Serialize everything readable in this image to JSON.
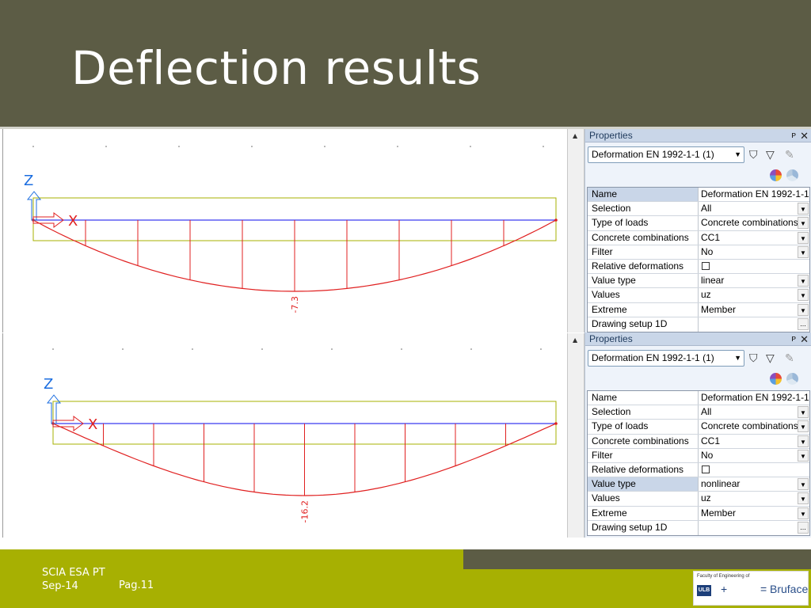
{
  "slide": {
    "title": "Deflection results"
  },
  "footer": {
    "app": "SCIA ESA PT",
    "date": "Sep-14",
    "page": "Pag.11",
    "logo_caption": "Faculty of Engineering of",
    "logo_ulb": "ULB",
    "logo_plus": "+",
    "logo_eq": "=",
    "logo_name": "Bruface"
  },
  "views": [
    {
      "axis_z": "Z",
      "axis_x": "X",
      "max_label": "-7.3",
      "deflection_shape": "linear",
      "max_value": -7.3
    },
    {
      "axis_z": "Z",
      "axis_x": "X",
      "max_label": "-16.2",
      "deflection_shape": "nonlinear",
      "max_value": -16.2
    }
  ],
  "colors": {
    "header_bg": "#5c5c45",
    "footer_bg": "#a7b002",
    "beam_axis": "#3a3af0",
    "beam_outline": "#a7b002",
    "deflection": "#e02020",
    "axis_icon": "#1c6ee0"
  },
  "panels": [
    {
      "title": "Properties",
      "pin": "ᴘ",
      "close": "✕",
      "select_value": "Deformation EN 1992-1-1 (1)",
      "selected_row": 0,
      "rows": [
        {
          "name": "Name",
          "value": "Deformation EN 1992-1-1",
          "control": "none"
        },
        {
          "name": "Selection",
          "value": "All",
          "control": "dropdown"
        },
        {
          "name": "Type of loads",
          "value": "Concrete combinations",
          "control": "dropdown"
        },
        {
          "name": "Concrete combinations",
          "value": "CC1",
          "control": "dropdown"
        },
        {
          "name": "Filter",
          "value": "No",
          "control": "dropdown"
        },
        {
          "name": "Relative deformations",
          "value": "",
          "control": "checkbox"
        },
        {
          "name": "Value type",
          "value": "linear",
          "control": "dropdown"
        },
        {
          "name": "Values",
          "value": "uz",
          "control": "dropdown"
        },
        {
          "name": "Extreme",
          "value": "Member",
          "control": "dropdown"
        },
        {
          "name": "Drawing setup 1D",
          "value": "",
          "control": "ellipsis"
        }
      ]
    },
    {
      "title": "Properties",
      "pin": "ᴘ",
      "close": "✕",
      "select_value": "Deformation EN 1992-1-1 (1)",
      "selected_row": 6,
      "rows": [
        {
          "name": "Name",
          "value": "Deformation EN 1992-1-1",
          "control": "none"
        },
        {
          "name": "Selection",
          "value": "All",
          "control": "dropdown"
        },
        {
          "name": "Type of loads",
          "value": "Concrete combinations",
          "control": "dropdown"
        },
        {
          "name": "Concrete combinations",
          "value": "CC1",
          "control": "dropdown"
        },
        {
          "name": "Filter",
          "value": "No",
          "control": "dropdown"
        },
        {
          "name": "Relative deformations",
          "value": "",
          "control": "checkbox"
        },
        {
          "name": "Value type",
          "value": "nonlinear",
          "control": "dropdown"
        },
        {
          "name": "Values",
          "value": "uz",
          "control": "dropdown"
        },
        {
          "name": "Extreme",
          "value": "Member",
          "control": "dropdown"
        },
        {
          "name": "Drawing setup 1D",
          "value": "",
          "control": "ellipsis"
        }
      ]
    }
  ]
}
